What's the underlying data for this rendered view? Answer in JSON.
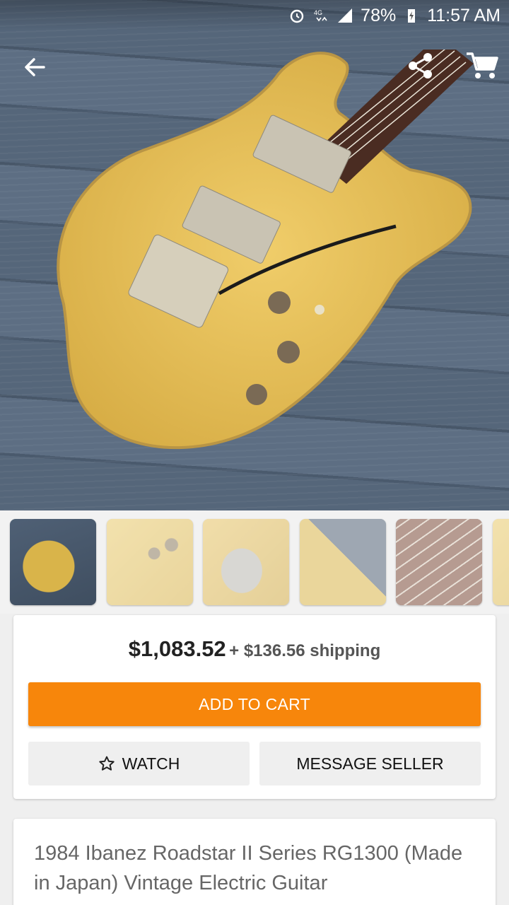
{
  "status_bar": {
    "battery": "78%",
    "time": "11:57 AM",
    "icons": [
      "alarm-icon",
      "lte-icon",
      "signal-icon",
      "battery-charging-icon"
    ]
  },
  "top_bar": {
    "icons": [
      "back-arrow-icon",
      "share-icon",
      "cart-icon"
    ]
  },
  "gallery": {
    "thumbnail_count_visible": 6,
    "selected_index": 0
  },
  "listing": {
    "price": "$1,083.52",
    "shipping": "+ $136.56 shipping",
    "add_to_cart_label": "ADD TO CART",
    "watch_label": "WATCH",
    "message_seller_label": "MESSAGE SELLER",
    "title": "1984 Ibanez Roadstar II Series RG1300 (Made in Japan) Vintage Electric Guitar"
  },
  "colors": {
    "accent": "#f7860b",
    "card_bg": "#ffffff",
    "page_bg": "#efefef"
  }
}
